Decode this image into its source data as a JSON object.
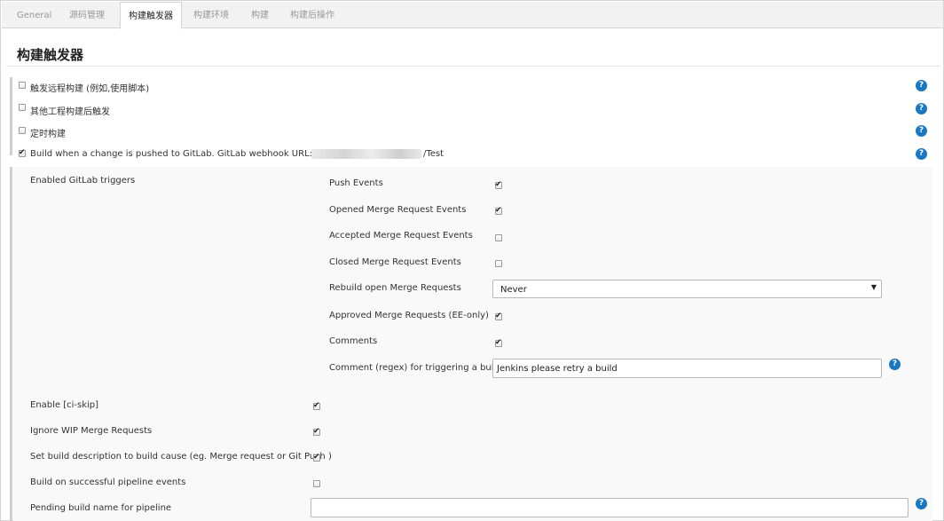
{
  "tabs": [
    {
      "label": "General"
    },
    {
      "label": "源码管理"
    },
    {
      "label": "构建触发器"
    },
    {
      "label": "构建环境"
    },
    {
      "label": "构建"
    },
    {
      "label": "构建后操作"
    }
  ],
  "active_tab": "构建触发器",
  "section_title": "构建触发器",
  "triggers": [
    {
      "label": "触发远程构建 (例如,使用脚本)",
      "checked": false
    },
    {
      "label": "其他工程构建后触发",
      "checked": false
    },
    {
      "label": "定时构建",
      "checked": false
    },
    {
      "label_prefix": "Build when a change is pushed to GitLab. GitLab webhook URL: http:/",
      "label_suffix": "/Test",
      "checked": true
    }
  ],
  "gitlab": {
    "enabled_triggers_label": "Enabled GitLab triggers",
    "events": [
      {
        "label": "Push Events",
        "checked": true
      },
      {
        "label": "Opened Merge Request Events",
        "checked": true
      },
      {
        "label": "Accepted Merge Request Events",
        "checked": false
      },
      {
        "label": "Closed Merge Request Events",
        "checked": false
      }
    ],
    "rebuild_label": "Rebuild open Merge Requests",
    "rebuild_value": "Never",
    "approved_label": "Approved Merge Requests (EE-only)",
    "approved_checked": true,
    "comments_label": "Comments",
    "comments_checked": true,
    "comment_regex_label": "Comment (regex) for triggering a build",
    "comment_regex_value": "Jenkins please retry a build",
    "options": [
      {
        "label": "Enable [ci-skip]",
        "checked": true
      },
      {
        "label": "Ignore WIP Merge Requests",
        "checked": true
      },
      {
        "label": "Set build description to build cause (eg. Merge request or Git Push )",
        "checked": true
      },
      {
        "label": "Build on successful pipeline events",
        "checked": false
      }
    ],
    "pending_label": "Pending build name for pipeline",
    "pending_value": ""
  },
  "help_glyph": "?",
  "checkmark_glyph": "✔",
  "dropdown_glyph": "▼",
  "colors": {
    "help": "#1a78c2",
    "band": "#f9f9f9"
  }
}
